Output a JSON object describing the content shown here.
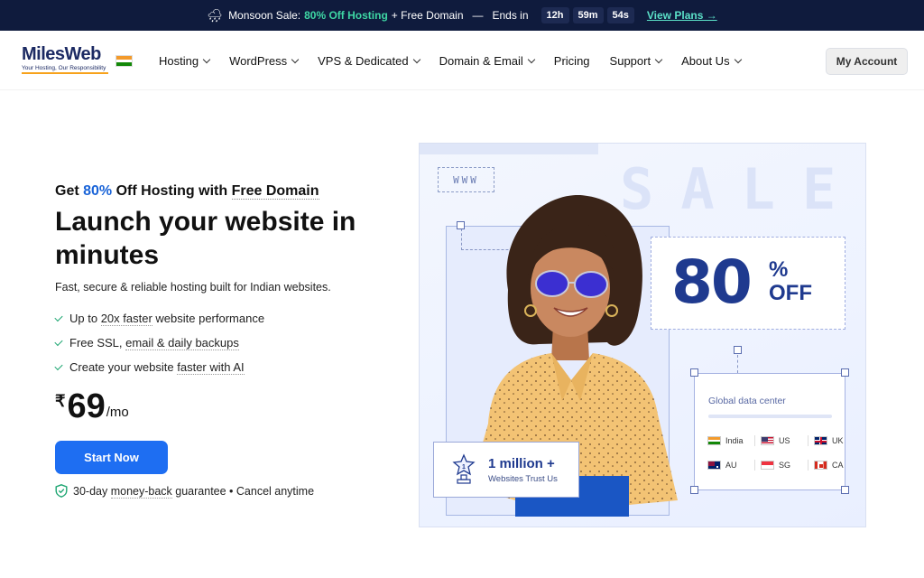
{
  "promo": {
    "emoji": "🌧",
    "prefix": "Monsoon Sale:",
    "highlight": "80% Off Hosting",
    "suffix": "+ Free Domain",
    "sep": "—",
    "ends_label": "Ends in",
    "timer": [
      "12h",
      "59m",
      "54s"
    ],
    "cta": "View Plans →"
  },
  "header": {
    "logo_name": "MilesWeb",
    "logo_tagline": "Your Hosting, Our Responsibility",
    "nav": [
      {
        "label": "Hosting",
        "dropdown": true
      },
      {
        "label": "WordPress",
        "dropdown": true
      },
      {
        "label": "VPS & Dedicated",
        "dropdown": true
      },
      {
        "label": "Domain & Email",
        "dropdown": true
      },
      {
        "label": "Pricing",
        "dropdown": false
      },
      {
        "label": "Support",
        "dropdown": true
      },
      {
        "label": "About Us",
        "dropdown": true
      }
    ],
    "account_label": "My Account"
  },
  "hero": {
    "eyebrow_pre": "Get",
    "eyebrow_pct": "80%",
    "eyebrow_mid": "Off Hosting with",
    "eyebrow_end": "Free Domain",
    "title": "Launch your website in minutes",
    "subtitle": "Fast, secure & reliable hosting built for Indian websites.",
    "features": [
      {
        "pre": "Up to ",
        "u": "20x faster",
        "post": " website performance"
      },
      {
        "pre": "Free SSL, ",
        "u": "email & daily backups",
        "post": ""
      },
      {
        "pre": "Create your website ",
        "u": "faster with AI",
        "post": ""
      }
    ],
    "currency": "₹",
    "price": "69",
    "per": "/mo",
    "cta": "Start Now",
    "guarantee_pre": "30-day ",
    "guarantee_u": "money-back",
    "guarantee_post": " guarantee • Cancel anytime"
  },
  "visual": {
    "www": "WWW",
    "sale_word": "SALE",
    "off_number": "80",
    "off_pct": "%",
    "off_word": "OFF",
    "dc_title": "Global data center",
    "locations_row1": [
      {
        "name": "India",
        "flag": "india-flag-icon"
      },
      {
        "name": "US",
        "flag": "us-flag-icon"
      },
      {
        "name": "UK",
        "flag": "uk-flag-icon"
      }
    ],
    "locations_row2": [
      {
        "name": "AU",
        "flag": "au-flag-icon"
      },
      {
        "name": "SG",
        "flag": "sg-flag-icon"
      },
      {
        "name": "CA",
        "flag": "ca-flag-icon"
      }
    ],
    "million_big": "1 million +",
    "million_small": "Websites Trust Us"
  },
  "colors": {
    "promo_bg": "#0f1b3d",
    "promo_accent": "#3ed6a4",
    "brand_navy": "#1c2a63",
    "cta_blue": "#1e6ef2",
    "pct_blue": "#1a64d8",
    "check_green": "#1ea672"
  }
}
